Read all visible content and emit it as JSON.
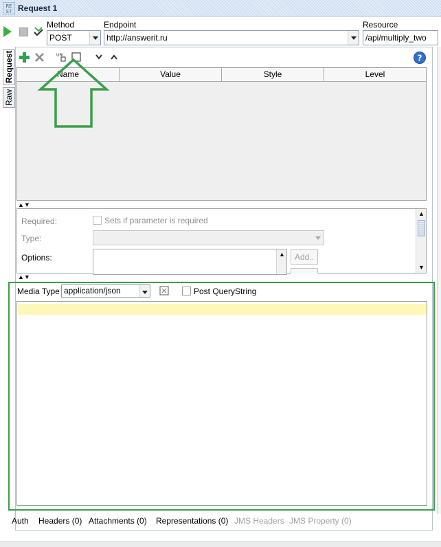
{
  "window": {
    "title": "Request 1",
    "icon_text": "RE\nST"
  },
  "toolbar": {
    "method_label": "Method",
    "method_value": "POST",
    "endpoint_label": "Endpoint",
    "endpoint_value": "http://answerit.ru",
    "resource_label": "Resource",
    "resource_value": "/api/multiply_two"
  },
  "side_tabs": [
    "Request",
    "Raw"
  ],
  "params_table": {
    "columns": [
      "Name",
      "Value",
      "Style",
      "Level"
    ],
    "rows": []
  },
  "details": {
    "required_label": "Required:",
    "required_checkbox_label": "Sets if parameter is required",
    "type_label": "Type:",
    "options_label": "Options:",
    "add_button": "Add.."
  },
  "media": {
    "media_type_label": "Media Type",
    "media_type_value": "application/json",
    "post_querystring_label": "Post QueryString"
  },
  "bottom_tabs": [
    {
      "label": "Auth",
      "enabled": true
    },
    {
      "label": "Headers (0)",
      "enabled": true
    },
    {
      "label": "Attachments (0)",
      "enabled": true
    },
    {
      "label": "Representations (0)",
      "enabled": true
    },
    {
      "label": "JMS Headers",
      "enabled": false
    },
    {
      "label": "JMS Property (0)",
      "enabled": false
    }
  ],
  "colors": {
    "highlight_green": "#3a9e4a",
    "editor_line": "#fdf8b8",
    "play_green": "#3cb043"
  }
}
